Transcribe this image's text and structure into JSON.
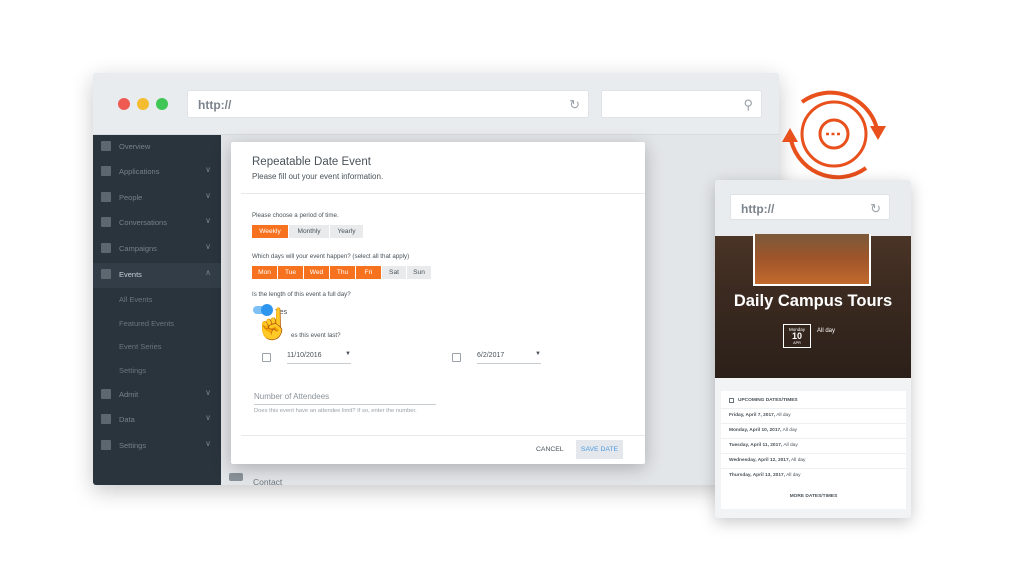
{
  "browser": {
    "url": "http://",
    "window_controls": [
      {
        "name": "close",
        "color": "#ee5a52"
      },
      {
        "name": "minimize",
        "color": "#f4bc2f"
      },
      {
        "name": "maximize",
        "color": "#3fc655"
      }
    ]
  },
  "sidebar": {
    "items": [
      {
        "label": "Overview",
        "icon": "grid-icon",
        "chevron": false
      },
      {
        "label": "Applications",
        "icon": "building-icon",
        "chevron": true
      },
      {
        "label": "People",
        "icon": "people-icon",
        "chevron": true
      },
      {
        "label": "Conversations",
        "icon": "chat-icon",
        "chevron": true
      },
      {
        "label": "Campaigns",
        "icon": "megaphone-icon",
        "chevron": true
      },
      {
        "label": "Events",
        "icon": "calendar-icon",
        "chevron": true,
        "active": true
      },
      {
        "label": "All Events",
        "sub": true
      },
      {
        "label": "Featured Events",
        "sub": true
      },
      {
        "label": "Event Series",
        "sub": true
      },
      {
        "label": "Settings",
        "sub": true
      },
      {
        "label": "Admit",
        "icon": "gear-icon",
        "chevron": true
      },
      {
        "label": "Data",
        "icon": "cloud-icon",
        "chevron": true
      },
      {
        "label": "Settings",
        "icon": "settings-icon",
        "chevron": true
      }
    ]
  },
  "main": {
    "contact_label": "Contact"
  },
  "modal": {
    "title": "Repeatable Date Event",
    "subtitle": "Please fill out your event information.",
    "period_question": "Please choose a period of time.",
    "period_options": [
      "Weekly",
      "Monthly",
      "Yearly"
    ],
    "period_selected": "Weekly",
    "days_question": "Which days will your event happen? (select all that apply)",
    "day_options": [
      "Mon",
      "Tue",
      "Wed",
      "Thu",
      "Fri",
      "Sat",
      "Sun"
    ],
    "days_selected": [
      "Mon",
      "Tue",
      "Wed",
      "Thu",
      "Fri"
    ],
    "fullday_question": "Is the length of this event a full day?",
    "fullday_toggle_label": "Yes",
    "fullday_on": true,
    "duration_question": "es this event last?",
    "start_date": "11/10/2016",
    "end_date": "6/2/2017",
    "attendees_placeholder": "Number of Attendees",
    "attendees_hint": "Does this event have an attendee limit? If so, enter the number.",
    "cancel_label": "CANCEL",
    "save_label": "SAVE DATE"
  },
  "mobile": {
    "url": "http://",
    "event_title": "Daily Campus Tours",
    "date_weekday": "Monday",
    "date_day": "10",
    "date_month": "APR",
    "all_day_label": "All day",
    "upcoming_header": "UPCOMING DATES/TIMES",
    "upcoming": [
      {
        "date": "Friday, April 7, 2017,",
        "time": "All day"
      },
      {
        "date": "Monday, April 10, 2017,",
        "time": "All day"
      },
      {
        "date": "Tuesday, April 11, 2017,",
        "time": "All day"
      },
      {
        "date": "Wednesday, April 12, 2017,",
        "time": "All day"
      },
      {
        "date": "Thursday, April 13, 2017,",
        "time": "All day"
      }
    ],
    "more_label": "MORE DATES/TIMES"
  },
  "colors": {
    "accent_orange": "#f7721e",
    "toggle_blue": "#2f96ef",
    "sidebar_bg": "#2a343d",
    "sync_orange": "#e8501c"
  }
}
